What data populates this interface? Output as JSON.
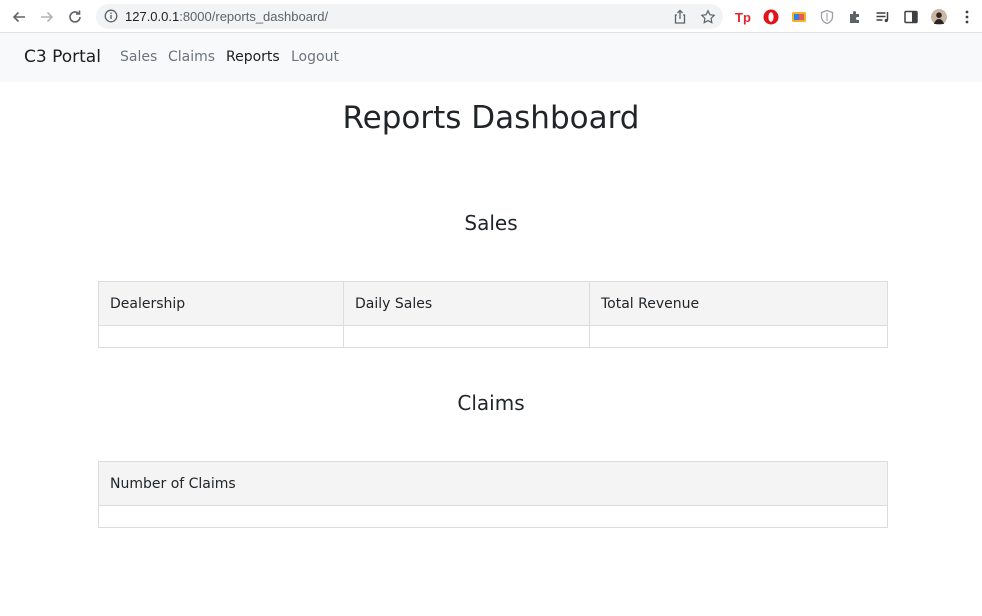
{
  "browser": {
    "url_host": "127.0.0.1",
    "url_path": ":8000/reports_dashboard/"
  },
  "navbar": {
    "brand": "C3 Portal",
    "links": [
      "Sales",
      "Claims",
      "Reports",
      "Logout"
    ],
    "active": "Reports"
  },
  "page": {
    "title": "Reports Dashboard"
  },
  "sales": {
    "heading": "Sales",
    "columns": [
      "Dealership",
      "Daily Sales",
      "Total Revenue"
    ]
  },
  "claims": {
    "heading": "Claims",
    "columns": [
      "Number of Claims"
    ]
  },
  "colors": {
    "navbar_bg": "#f8f9fa",
    "table_header_bg": "#f4f4f4",
    "text": "#212529",
    "muted_link": "#6c757d"
  }
}
